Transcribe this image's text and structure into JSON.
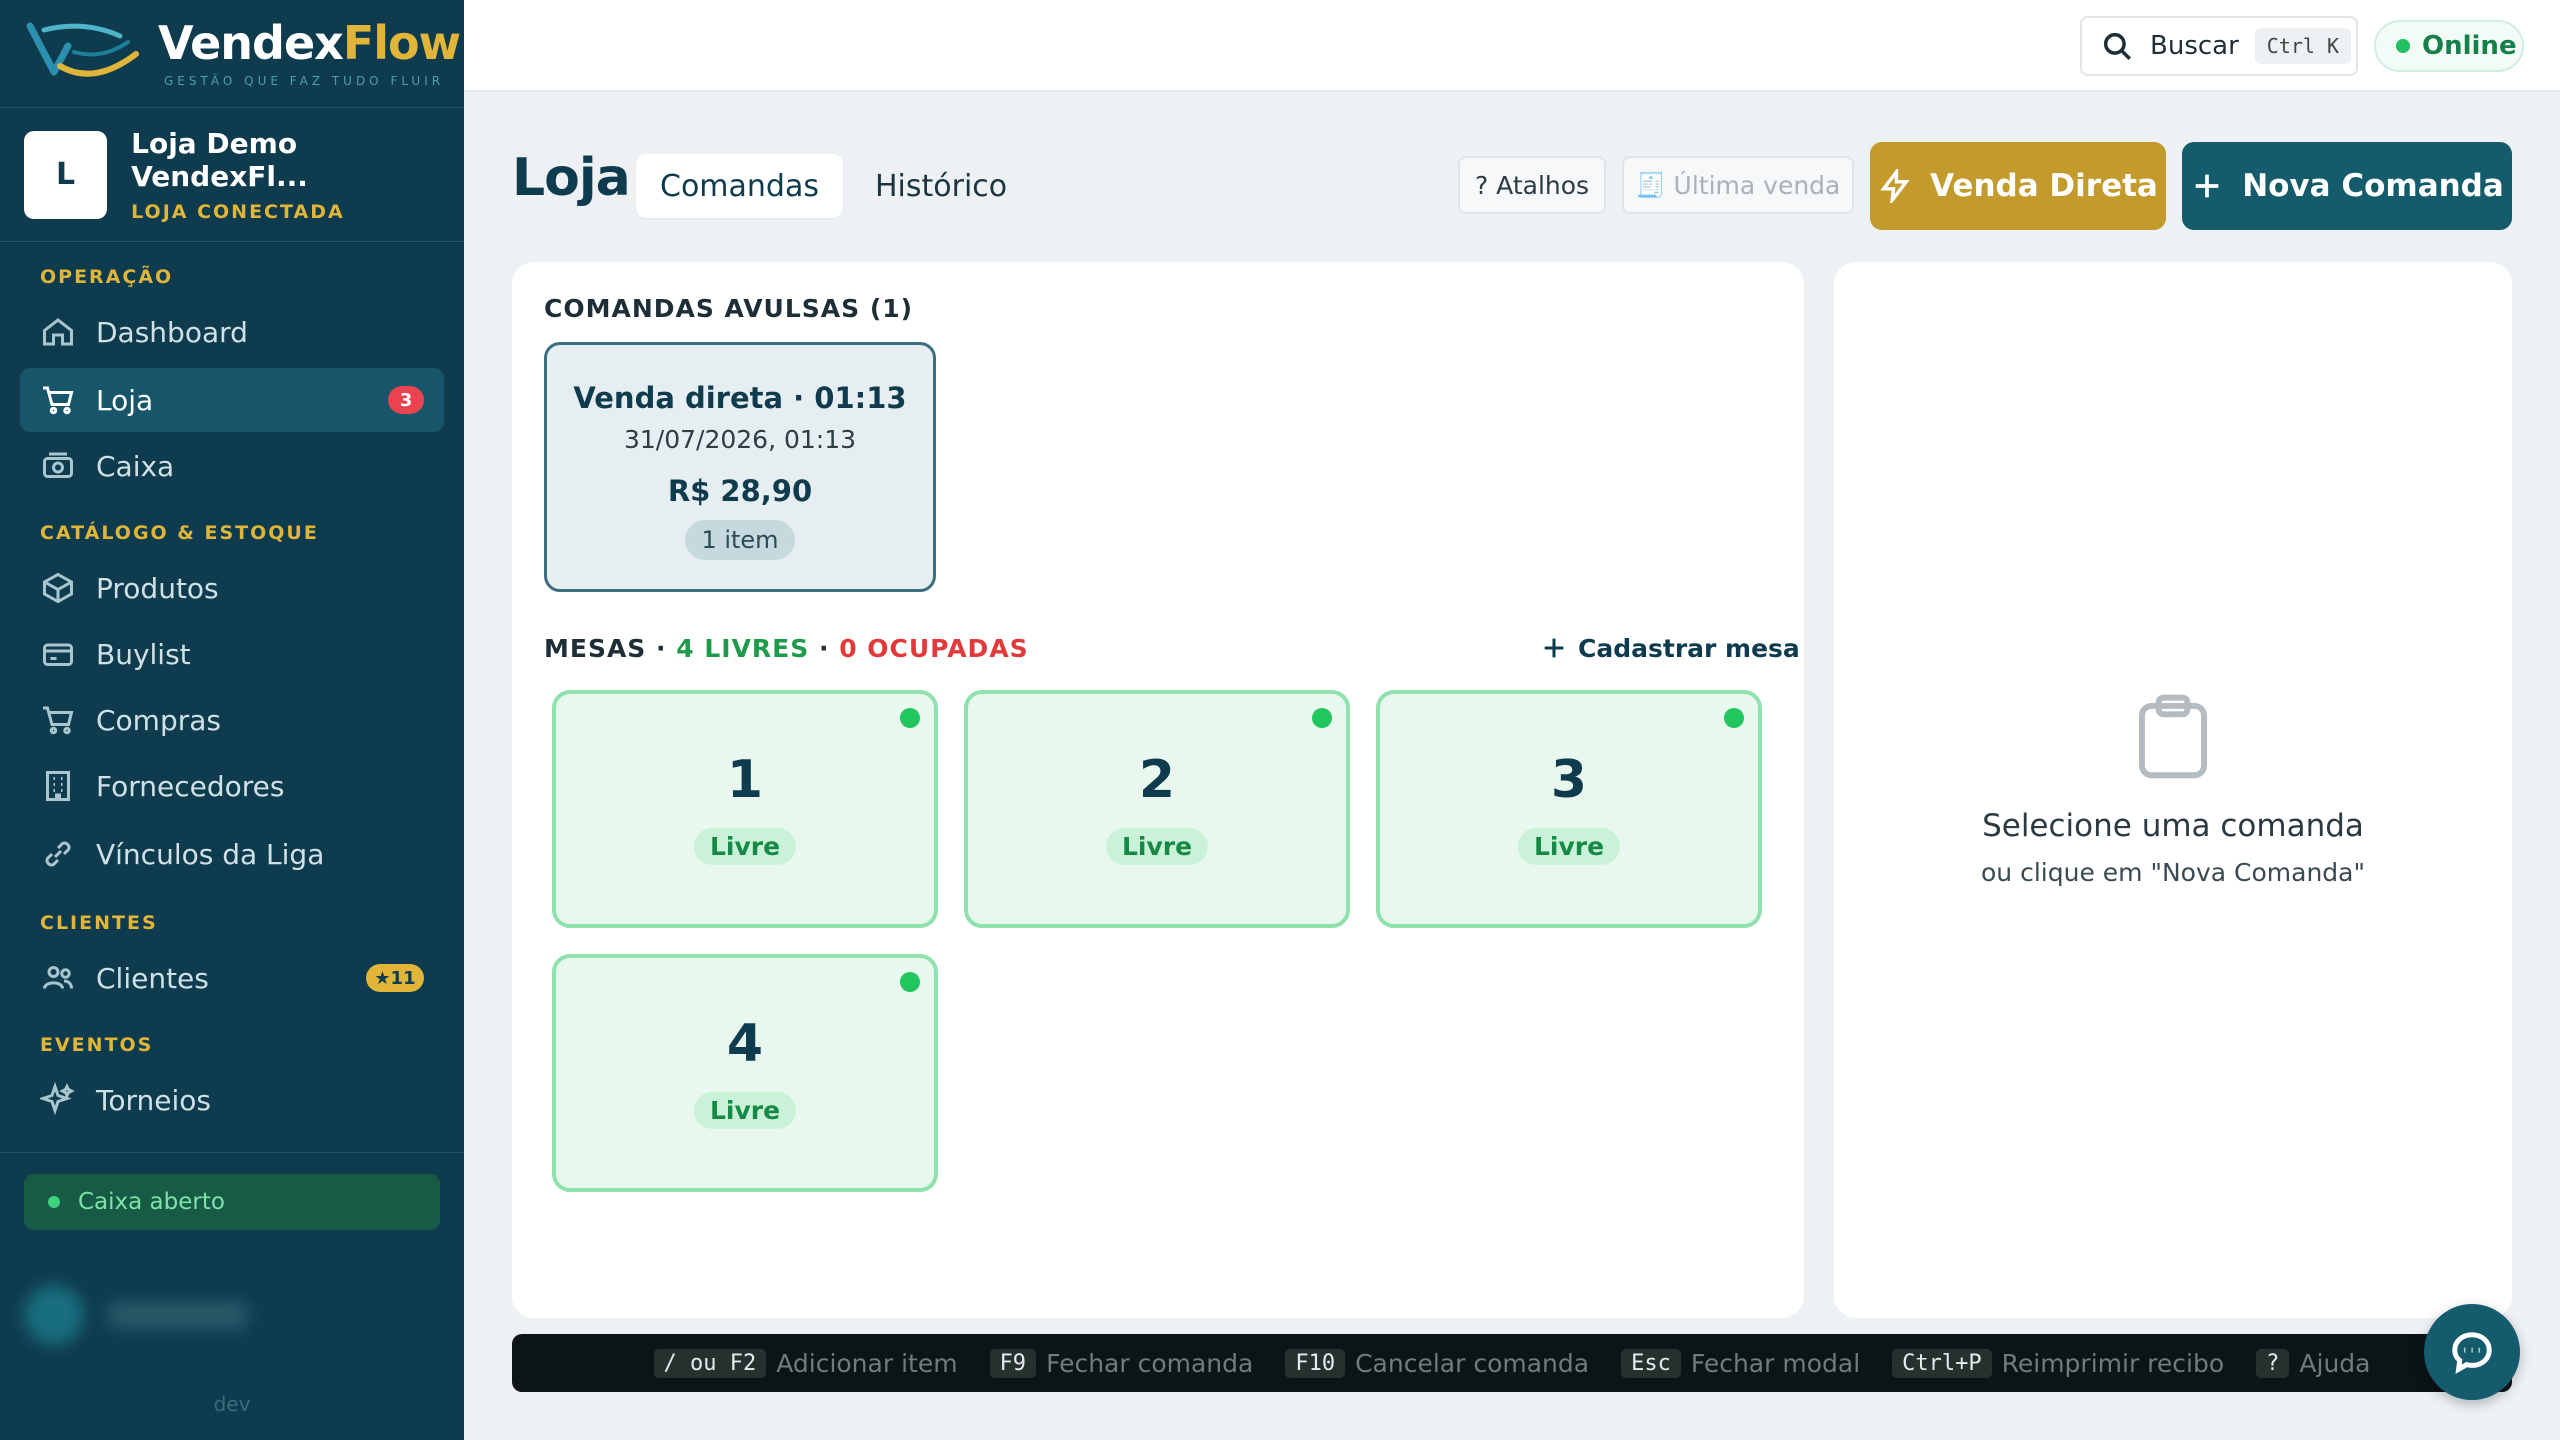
{
  "brand": {
    "name_part1": "Vendex",
    "name_part2": "Flow",
    "tagline": "GESTÃO QUE FAZ TUDO FLUIR"
  },
  "store": {
    "initial": "L",
    "name": "Loja Demo VendexFl...",
    "status": "LOJA CONECTADA"
  },
  "nav": {
    "sections": {
      "operacao": "OPERAÇÃO",
      "catalogo": "CATÁLOGO & ESTOQUE",
      "clientes": "CLIENTES",
      "eventos": "EVENTOS"
    },
    "items": {
      "dashboard": "Dashboard",
      "loja": "Loja",
      "loja_badge": "3",
      "caixa": "Caixa",
      "produtos": "Produtos",
      "buylist": "Buylist",
      "compras": "Compras",
      "fornecedores": "Fornecedores",
      "vinculos": "Vínculos da Liga",
      "clientes": "Clientes",
      "clientes_badge": "★11",
      "torneios": "Torneios"
    }
  },
  "sidebar_footer": {
    "caixa_status": "Caixa aberto",
    "env": "dev"
  },
  "topbar": {
    "search_label": "Buscar",
    "search_shortcut": "Ctrl K",
    "status": "Online"
  },
  "header": {
    "title": "Loja",
    "tabs": [
      "Comandas",
      "Histórico"
    ],
    "atalhos": "? Atalhos",
    "ultima_venda": "Última venda",
    "venda_direta": "Venda Direta",
    "nova_comanda": "Nova Comanda"
  },
  "comandas": {
    "section_title": "COMANDAS AVULSAS (1)",
    "items": [
      {
        "title": "Venda direta · 01:13",
        "datetime": "31/07/2026, 01:13",
        "total": "R$ 28,90",
        "count": "1 item"
      }
    ]
  },
  "mesas": {
    "label": "MESAS ·",
    "livres": "4 LIVRES",
    "sep": "·",
    "ocupadas": "0 OCUPADAS",
    "cadastrar": "Cadastrar mesa",
    "items": [
      {
        "number": "1",
        "status": "Livre"
      },
      {
        "number": "2",
        "status": "Livre"
      },
      {
        "number": "3",
        "status": "Livre"
      },
      {
        "number": "4",
        "status": "Livre"
      }
    ]
  },
  "detail_panel": {
    "title": "Selecione uma comanda",
    "subtitle": "ou clique em \"Nova Comanda\""
  },
  "shortcuts": [
    {
      "key": "/ ou F2",
      "label": "Adicionar item"
    },
    {
      "key": "F9",
      "label": "Fechar comanda"
    },
    {
      "key": "F10",
      "label": "Cancelar comanda"
    },
    {
      "key": "Esc",
      "label": "Fechar modal"
    },
    {
      "key": "Ctrl+P",
      "label": "Reimprimir recibo"
    },
    {
      "key": "?",
      "label": "Ajuda"
    }
  ],
  "colors": {
    "sidebar": "#0e3b4d",
    "gold": "#c39a2c",
    "primary": "#145b6c",
    "free": "#22c65e",
    "occupied": "#e23a3a"
  }
}
